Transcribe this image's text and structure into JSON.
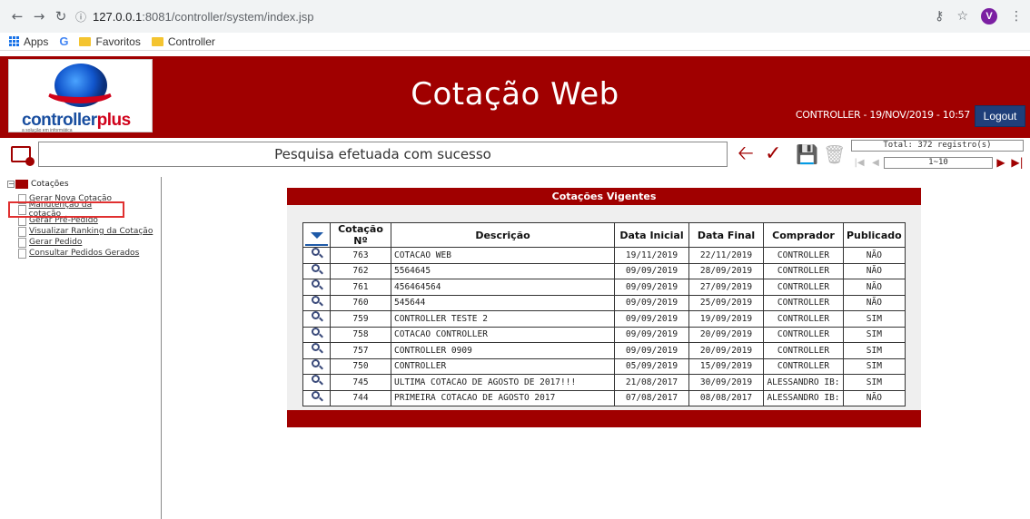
{
  "browser": {
    "url_host": "127.0.0.1",
    "url_path": ":8081/controller/system/index.jsp",
    "avatar_letter": "V",
    "bookmarks": [
      {
        "label": "Apps"
      },
      {
        "label": "Favoritos"
      },
      {
        "label": "Controller"
      }
    ]
  },
  "header": {
    "logo_text_main": "controller",
    "logo_text_accent": "plus",
    "logo_sub": "a solução em informática",
    "title": "Cotação Web",
    "user_info": "CONTROLLER - 19/NOV/2019 - 10:57",
    "logout_label": "Logout",
    "colors": {
      "primary": "#a00000",
      "logout": "#1f3f7a"
    }
  },
  "toolbar": {
    "message": "Pesquisa efetuada com sucesso",
    "total_label": "Total: 372 registro(s)",
    "page_range": "1~10",
    "icons": [
      "back-arrow-icon",
      "clear-icon",
      "save-icon",
      "delete-icon"
    ]
  },
  "sidebar": {
    "root_label": "Cotações",
    "items": [
      {
        "label": "Gerar Nova Cotação"
      },
      {
        "label": "Manutenção da cotação"
      },
      {
        "label": "Gerar Pré-Pedido"
      },
      {
        "label": "Visualizar Ranking da Cotação"
      },
      {
        "label": "Gerar Pedido"
      },
      {
        "label": "Consultar Pedidos Gerados"
      }
    ]
  },
  "panel": {
    "title": "Cotações Vigentes",
    "columns": [
      "Cotação Nº",
      "Descrição",
      "Data Inicial",
      "Data Final",
      "Comprador",
      "Publicado"
    ],
    "rows": [
      {
        "num": "763",
        "desc": "COTACAO WEB",
        "start": "19/11/2019",
        "end": "22/11/2019",
        "buyer": "CONTROLLER",
        "published": "NÃO"
      },
      {
        "num": "762",
        "desc": "5564645",
        "start": "09/09/2019",
        "end": "28/09/2019",
        "buyer": "CONTROLLER",
        "published": "NÃO"
      },
      {
        "num": "761",
        "desc": "456464564",
        "start": "09/09/2019",
        "end": "27/09/2019",
        "buyer": "CONTROLLER",
        "published": "NÃO"
      },
      {
        "num": "760",
        "desc": "545644",
        "start": "09/09/2019",
        "end": "25/09/2019",
        "buyer": "CONTROLLER",
        "published": "NÃO"
      },
      {
        "num": "759",
        "desc": "CONTROLLER TESTE 2",
        "start": "09/09/2019",
        "end": "19/09/2019",
        "buyer": "CONTROLLER",
        "published": "SIM"
      },
      {
        "num": "758",
        "desc": "COTACAO CONTROLLER",
        "start": "09/09/2019",
        "end": "20/09/2019",
        "buyer": "CONTROLLER",
        "published": "SIM"
      },
      {
        "num": "757",
        "desc": "CONTROLLER 0909",
        "start": "09/09/2019",
        "end": "20/09/2019",
        "buyer": "CONTROLLER",
        "published": "SIM"
      },
      {
        "num": "750",
        "desc": "CONTROLLER",
        "start": "05/09/2019",
        "end": "15/09/2019",
        "buyer": "CONTROLLER",
        "published": "SIM"
      },
      {
        "num": "745",
        "desc": "ULTIMA COTACAO DE AGOSTO DE 2017!!!",
        "start": "21/08/2017",
        "end": "30/09/2019",
        "buyer": "ALESSANDRO IB:",
        "published": "SIM"
      },
      {
        "num": "744",
        "desc": "PRIMEIRA COTACAO DE AGOSTO 2017",
        "start": "07/08/2017",
        "end": "08/08/2017",
        "buyer": "ALESSANDRO IB:",
        "published": "NÃO"
      }
    ]
  }
}
